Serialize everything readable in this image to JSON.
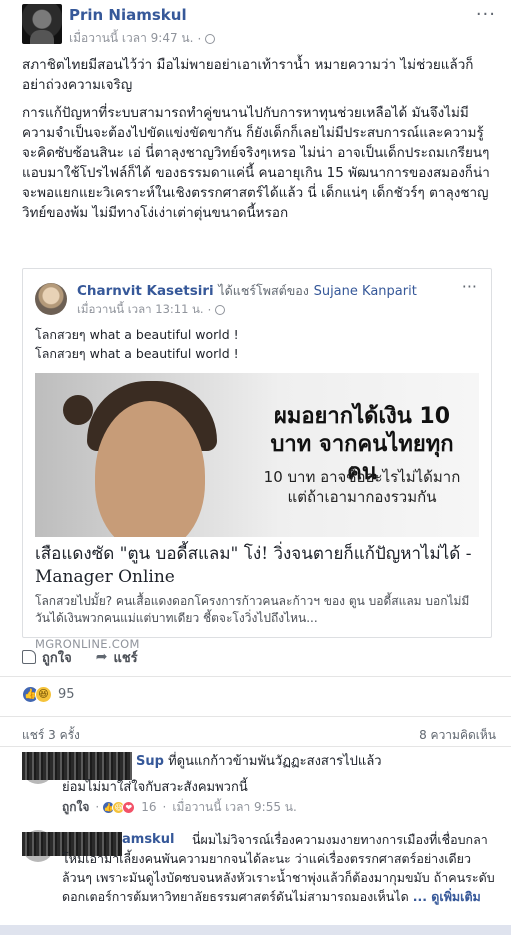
{
  "post": {
    "author": "Prin Niamskul",
    "time": "เมื่อวานนี้ เวลา 9:47 น.",
    "more": "···",
    "paragraph1": "สภาชิตไทยมีสอนไว้ว่า มือไม่พายอย่าเอาเท้าราน้ำ หมายความว่า ไม่ช่วยแล้วก็อย่าถ่วงความเจริญ",
    "paragraph2": "การแก้ปัญหาที่ระบบสามารถทำคู่ขนานไปกับการหาทุนช่วยเหลือได้ มันจึงไม่มีความจำเป็นจะต้องไปขัดแข่งขัดขากัน ก็ยังเด็กก็เลยไม่มีประสบการณ์และความรู้จะคิดซับซ้อนสินะ เอ่ นี่ตาลุงชาญวิทย์จริงๆเหรอ ไม่น่า อาจเป็นเด็กประถมเกรียนๆแอบมาใช้โปรไฟล์ก็ได้ ของธรรมดาแค่นี้ คนอายุเกิน 15 พัฒนาการของสมองก็น่าจะพอแยกแยะวิเคราะห์ในเชิงตรรกศาสตร์ได้แล้ว นี่ เด็กแน่ๆ เด็กชัวร์ๆ ตาลุงชาญวิทย์ของพ้ม ไม่มีทางโง่เง่าเต่าตุ่นขนาดนี้หรอก"
  },
  "shared": {
    "author": "Charnvit Kasetsiri",
    "action": "ได้แชร์โพสต์ของ",
    "target": "Sujane Kanparit",
    "time": "เมื่อวานนี้ เวลา 13:11 น.",
    "more": "···",
    "line1": "โลกสวยๆ what a beautiful world !",
    "line2": "โลกสวยๆ what a beautiful world !",
    "image_headline": "ผมอยากได้เงิน 10 บาท จากคนไทยทุกคน",
    "image_sub": "10 บาท อาจซื้ออะไรไม่ได้มาก แต่ถ้าเอามากองรวมกัน",
    "link_title": "เสือแดงซัด \"ตูน บอดี้สแลม\" โง่! วิ่งจนตายก็แก้ปัญหาไม่ได้ - Manager Online",
    "link_desc": "โลกสวยไปมั้ย? คนเสื้อแดงดอกโครงการก้าวคนละก้าวฯ ของ ตูน บอดี้สแลม บอกไม่มีวันได้เงินพวกคนแม่แต่บาทเดียว ชี้ตจะโงวิ่งไปถึงไหน...",
    "link_domain": "MGRONLINE.COM"
  },
  "actions": {
    "like": "ถูกใจ",
    "share": "แชร์"
  },
  "reactions": {
    "count": "95"
  },
  "stats": {
    "shares": "แชร์ 3 ครั้ง",
    "comments": "8 ความคิดเห็น"
  },
  "comments": [
    {
      "name": "Sup",
      "text": "ที่ดูนแกก้าวข้ามพันวัฏฏะสงสารไปแล้ว",
      "text2": "ย่อมไม่มาใส่ใจกับสวะสังคมพวกนี้",
      "like": "ถูกใจ",
      "reactions": "16",
      "time": "เมื่อวานนี้ เวลา 9:55 น."
    },
    {
      "name": "amskul",
      "text": "นี่ผมไม่วิจารณ์เรื่องความงมงายทางการเมืองที่เชื่อบกลาโหมเอามาเลี้ยงคนพันความยากจนได้ละนะ ว่าแค่เรื่องตรรกศาสตร์อย่างเดียวล้วนๆ เพราะมันดูไงบัดซบจนหลังหัวเราะน้ำชาพุ่งแล้วก็ต้องมากุมขมับ ถ้าคนระดับดอกเตอร์การต้มหาวิทยาลัยธรรมศาสตร์ดันไม่สามารถมองเห็นได",
      "more": "... ดูเพิ่มเติม"
    }
  ]
}
